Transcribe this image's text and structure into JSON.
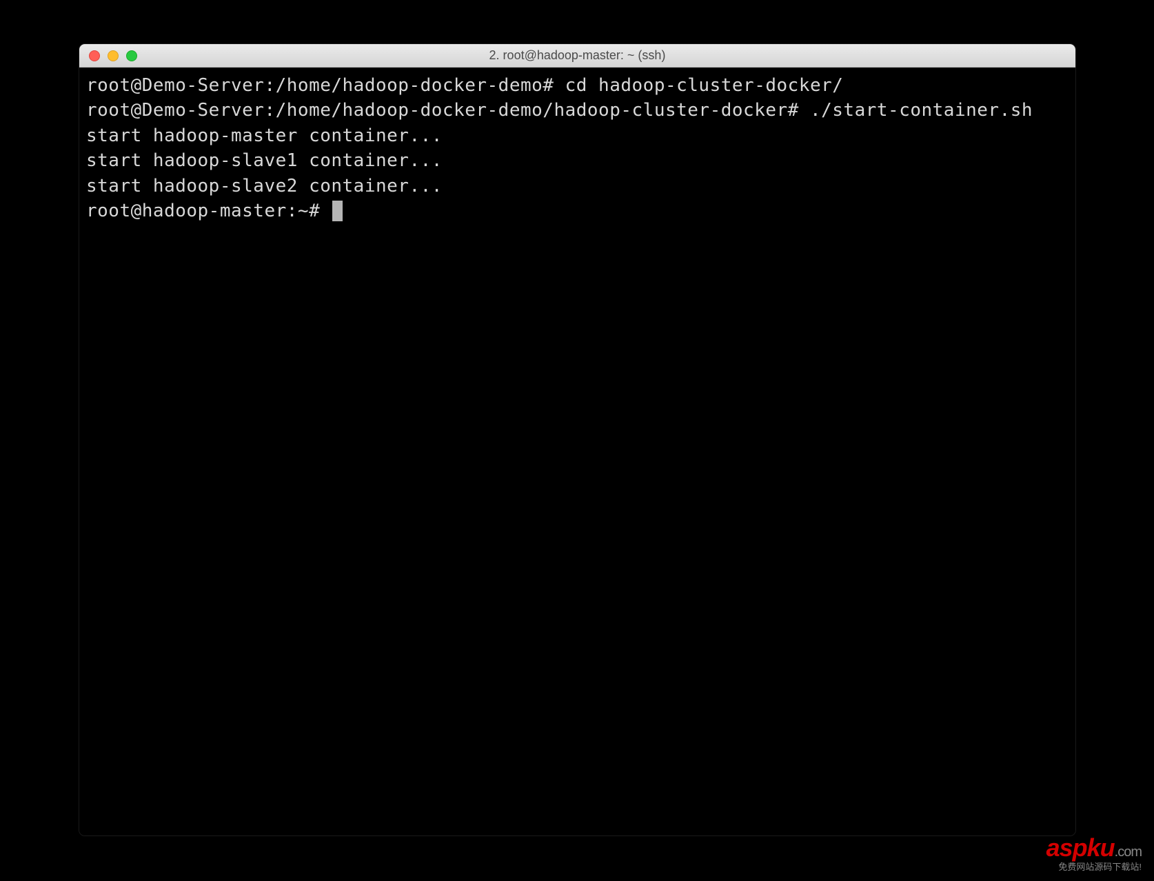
{
  "window": {
    "title": "2. root@hadoop-master: ~ (ssh)"
  },
  "terminal": {
    "lines": [
      "root@Demo-Server:/home/hadoop-docker-demo# cd hadoop-cluster-docker/",
      "root@Demo-Server:/home/hadoop-docker-demo/hadoop-cluster-docker# ./start-container.sh",
      "start hadoop-master container...",
      "start hadoop-slave1 container...",
      "start hadoop-slave2 container..."
    ],
    "prompt": "root@hadoop-master:~# "
  },
  "watermark": {
    "brand_red": "aspku",
    "brand_gray": ".com",
    "tagline": "免费网站源码下载站!"
  }
}
